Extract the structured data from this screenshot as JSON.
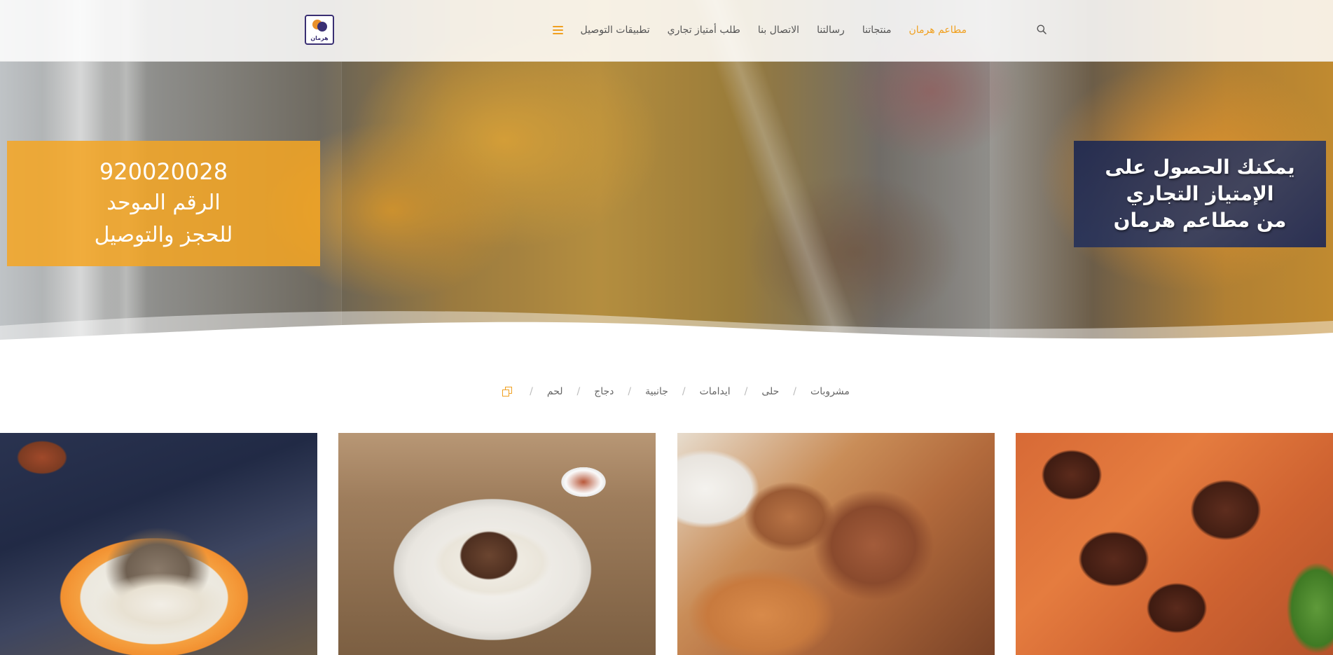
{
  "header": {
    "logo_text": "هرمان",
    "nav": [
      {
        "label": "تطبيقات التوصيل",
        "active": false
      },
      {
        "label": "طلب أمتياز تجاري",
        "active": false
      },
      {
        "label": "الاتصال بنا",
        "active": false
      },
      {
        "label": "رسالتنا",
        "active": false
      },
      {
        "label": "منتجاتنا",
        "active": false
      },
      {
        "label": "مطاعم هرمان",
        "active": true
      }
    ],
    "menu_icon": "hamburger-icon",
    "search_icon": "search-icon"
  },
  "hero": {
    "phone_box": {
      "number": "920020028",
      "line1": "الرقم الموحد",
      "line2": "للحجز والتوصيل"
    },
    "promo_box": {
      "line1": "يمكنك الحصول على",
      "line2": "الإمتياز التجاري",
      "line3": "من مطاعم هرمان"
    }
  },
  "filters": {
    "all_icon": "copy-icon",
    "items": [
      "مشروبات",
      "حلى",
      "ايدامات",
      "جانبية",
      "دجاج",
      "لحم"
    ]
  },
  "colors": {
    "accent": "#f0a020",
    "brand_navy": "#3a2f73",
    "promo_bg": "#1e2850"
  }
}
